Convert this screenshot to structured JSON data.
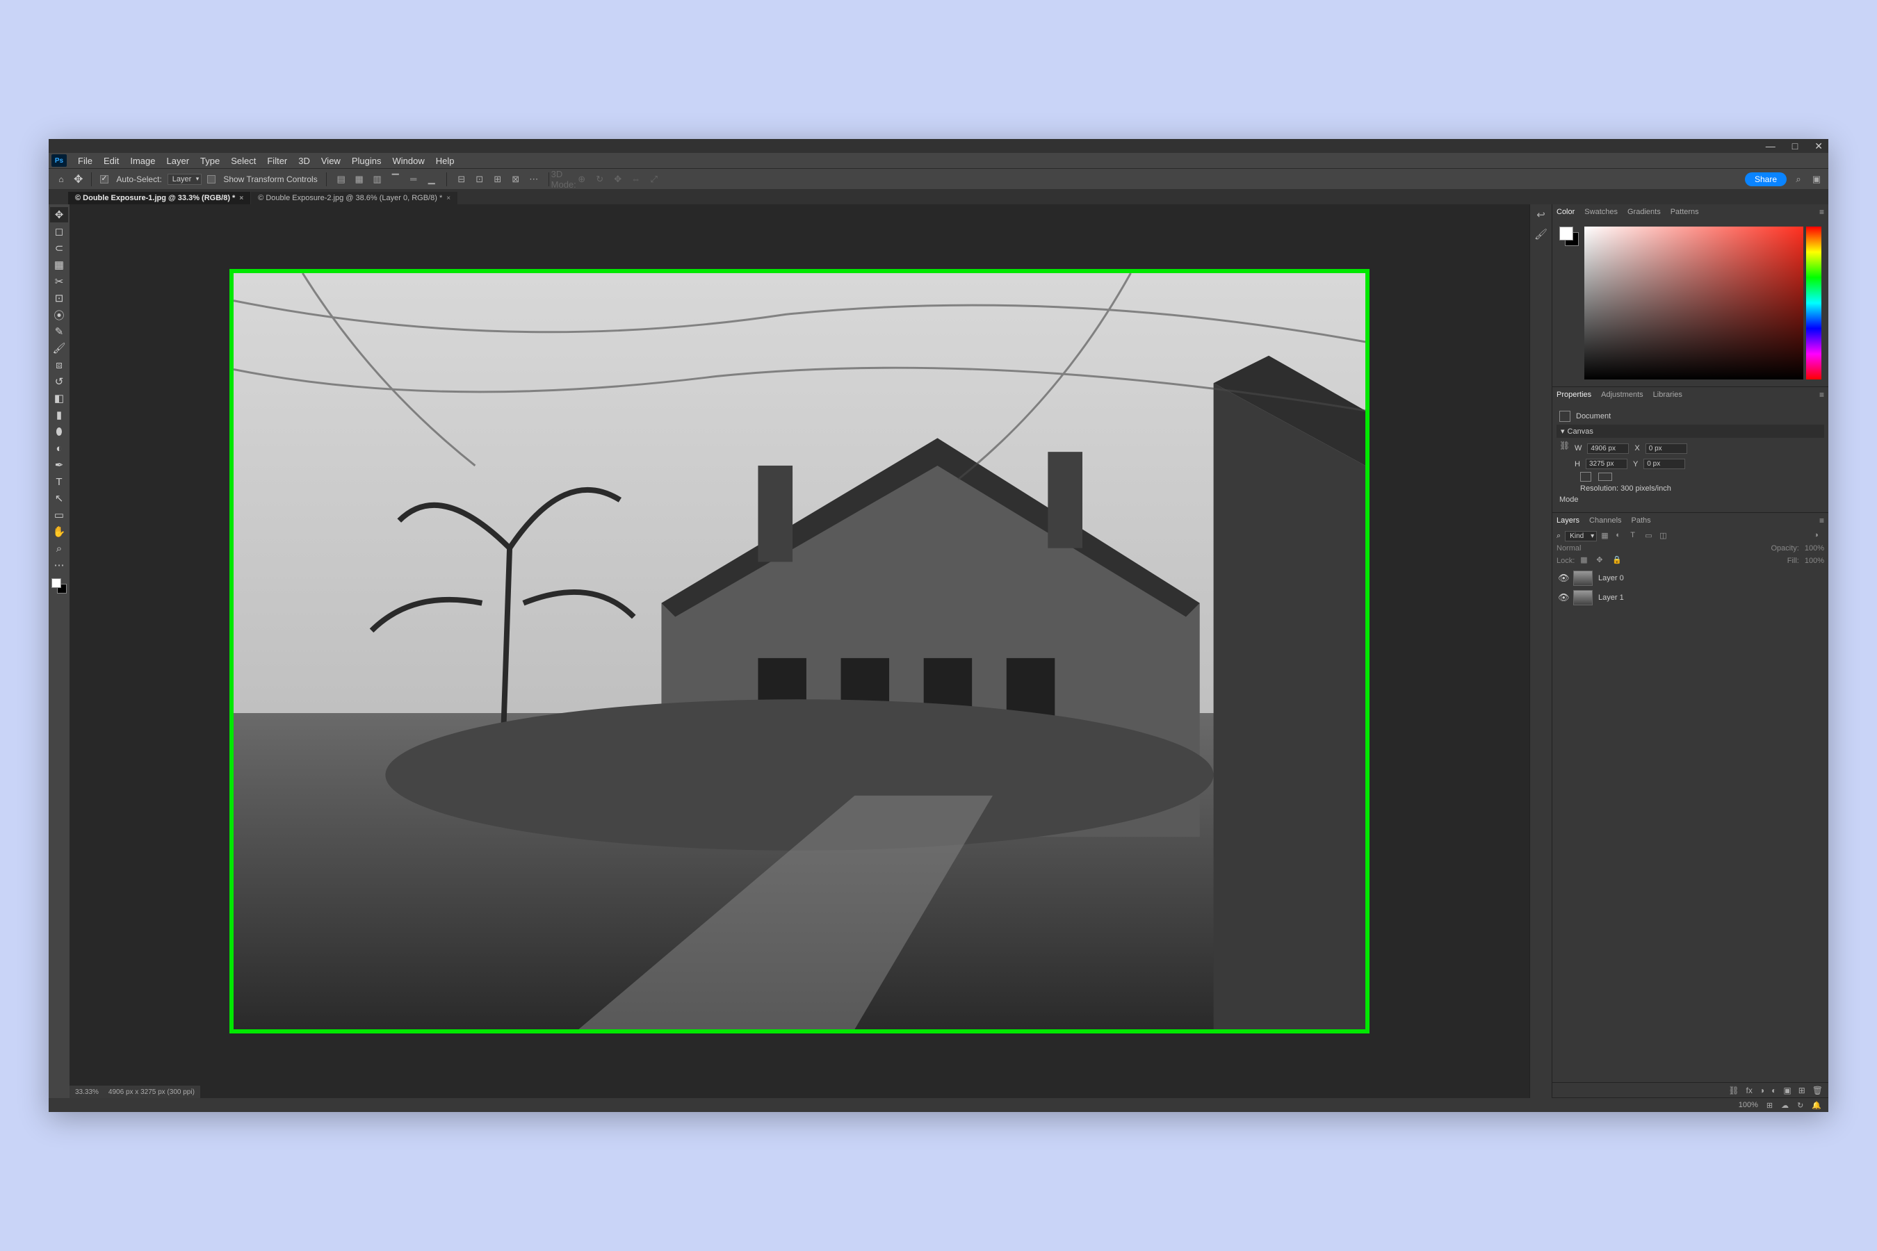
{
  "window_controls": {
    "min": "—",
    "max": "□",
    "close": "✕"
  },
  "menubar": [
    "File",
    "Edit",
    "Image",
    "Layer",
    "Type",
    "Select",
    "Filter",
    "3D",
    "View",
    "Plugins",
    "Window",
    "Help"
  ],
  "optionsbar": {
    "auto_select_checked": true,
    "auto_select_label": "Auto-Select:",
    "auto_select_dd": "Layer",
    "show_transform_checked": false,
    "show_transform_label": "Show Transform Controls",
    "mode3d_label": "3D Mode:",
    "share_label": "Share"
  },
  "tabs": [
    {
      "title": "© Double Exposure-1.jpg @ 33.3% (RGB/8) *",
      "active": true
    },
    {
      "title": "© Double Exposure-2.jpg @ 38.6% (Layer 0, RGB/8) *",
      "active": false
    }
  ],
  "statusbar": {
    "zoom": "33.33%",
    "info": "4906 px x 3275 px (300 ppi)"
  },
  "collapsed_panels": [
    "history-icon",
    "brush-icon"
  ],
  "panels": {
    "color": {
      "tabs": [
        "Color",
        "Swatches",
        "Gradients",
        "Patterns"
      ],
      "active": "Color"
    },
    "properties": {
      "tabs": [
        "Properties",
        "Adjustments",
        "Libraries"
      ],
      "active": "Properties",
      "doc_label": "Document",
      "canvas_label": "Canvas",
      "w_label": "W",
      "w_value": "4906 px",
      "x_label": "X",
      "x_value": "0 px",
      "h_label": "H",
      "h_value": "3275 px",
      "y_label": "Y",
      "y_value": "0 px",
      "resolution": "Resolution: 300 pixels/inch",
      "mode_label": "Mode"
    },
    "layers": {
      "tabs": [
        "Layers",
        "Channels",
        "Paths"
      ],
      "active": "Layers",
      "kind_label": "Kind",
      "blend": "Normal",
      "opacity_label": "Opacity:",
      "opacity": "100%",
      "lock_label": "Lock:",
      "fill_label": "Fill:",
      "fill": "100%",
      "items": [
        {
          "name": "Layer 0"
        },
        {
          "name": "Layer 1"
        }
      ]
    }
  },
  "footer": {
    "zoom": "100%"
  }
}
